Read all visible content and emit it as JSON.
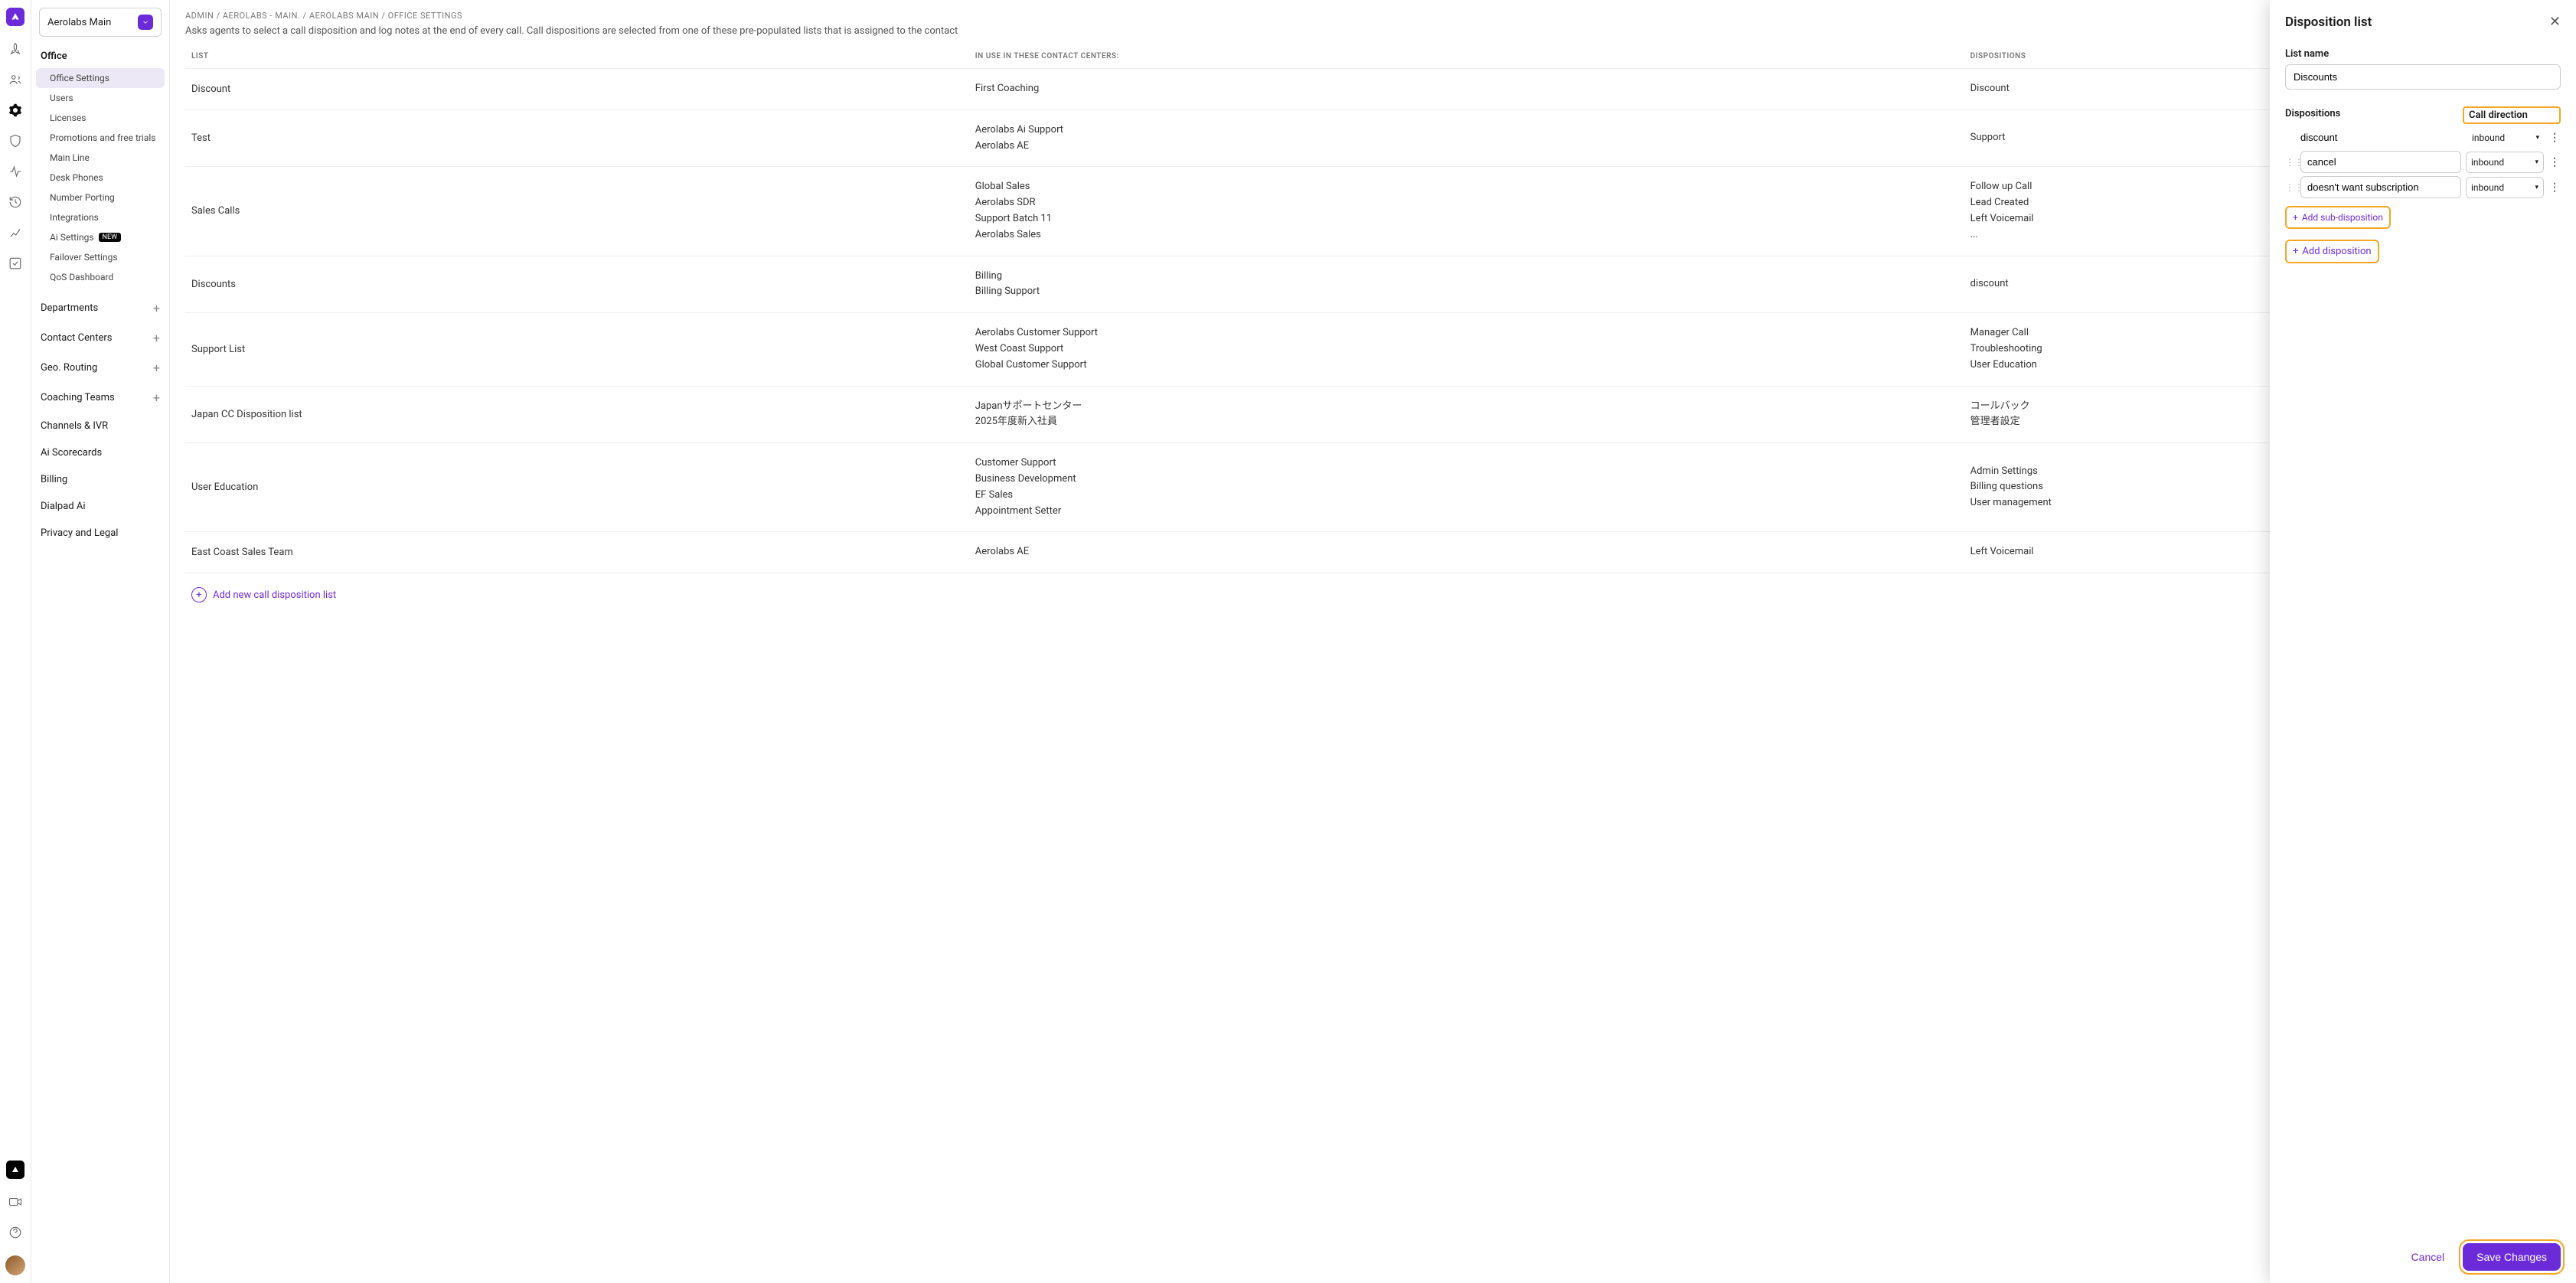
{
  "workspace": "Aerolabs Main",
  "breadcrumb": [
    "ADMIN",
    "AEROLABS - MAIN.",
    "AEROLABS MAIN",
    "OFFICE SETTINGS"
  ],
  "description": "Asks agents to select a call disposition and log notes at the end of every call. Call dispositions are selected from one of these pre-populated lists that is assigned to the contact",
  "sidebar": {
    "sectionOffice": "Office",
    "items": [
      {
        "label": "Office Settings",
        "active": true
      },
      {
        "label": "Users"
      },
      {
        "label": "Licenses"
      },
      {
        "label": "Promotions and free trials"
      },
      {
        "label": "Main Line"
      },
      {
        "label": "Desk Phones"
      },
      {
        "label": "Number Porting"
      },
      {
        "label": "Integrations"
      },
      {
        "label": "Ai Settings",
        "badge": "NEW"
      },
      {
        "label": "Failover Settings"
      },
      {
        "label": "QoS Dashboard"
      }
    ],
    "nav": [
      {
        "label": "Departments",
        "add": true
      },
      {
        "label": "Contact Centers",
        "add": true
      },
      {
        "label": "Geo. Routing",
        "add": true
      },
      {
        "label": "Coaching Teams",
        "add": true
      },
      {
        "label": "Channels & IVR"
      },
      {
        "label": "Ai Scorecards"
      },
      {
        "label": "Billing"
      },
      {
        "label": "Dialpad Ai"
      },
      {
        "label": "Privacy and Legal"
      }
    ]
  },
  "table": {
    "headers": [
      "LIST",
      "IN USE IN THESE CONTACT CENTERS:",
      "DISPOSITIONS"
    ],
    "rows": [
      {
        "list": "Discount",
        "centers": [
          "First Coaching"
        ],
        "disps": [
          "Discount"
        ]
      },
      {
        "list": "Test",
        "centers": [
          "Aerolabs Ai Support",
          "Aerolabs AE"
        ],
        "disps": [
          "Support"
        ]
      },
      {
        "list": "Sales Calls",
        "centers": [
          "Global Sales",
          "Aerolabs SDR",
          "Support Batch 11",
          "Aerolabs Sales"
        ],
        "disps": [
          "Follow up Call",
          "Lead Created",
          "Left Voicemail",
          "..."
        ]
      },
      {
        "list": "Discounts",
        "centers": [
          "Billing",
          "Billing Support"
        ],
        "disps": [
          "discount"
        ]
      },
      {
        "list": "Support List",
        "centers": [
          "Aerolabs Customer Support",
          "West Coast Support",
          "Global Customer Support"
        ],
        "disps": [
          "Manager Call",
          "Troubleshooting",
          "User Education"
        ]
      },
      {
        "list": "Japan CC Disposition list",
        "centers": [
          "Japanサポートセンター",
          "2025年度新入社員"
        ],
        "disps": [
          "コールバック",
          "管理者設定"
        ]
      },
      {
        "list": "User Education",
        "centers": [
          "Customer Support",
          "Business Development",
          "EF Sales",
          "Appointment Setter"
        ],
        "disps": [
          "Admin Settings",
          "Billing questions",
          "User management"
        ]
      },
      {
        "list": "East Coast Sales Team",
        "centers": [
          "Aerolabs AE"
        ],
        "disps": [
          "Left Voicemail"
        ]
      }
    ],
    "addLabel": "Add new call disposition list"
  },
  "panel": {
    "title": "Disposition list",
    "listNameLabel": "List name",
    "listName": "Discounts",
    "dispositionsLabel": "Dispositions",
    "callDirectionLabel": "Call direction",
    "rows": [
      {
        "name": "discount",
        "dir": "inbound",
        "grip": false
      },
      {
        "name": "cancel",
        "dir": "inbound",
        "grip": true
      },
      {
        "name": "doesn't want subscription",
        "dir": "inbound",
        "grip": true
      }
    ],
    "addSub": "Add sub-disposition",
    "addDisp": "Add disposition",
    "cancel": "Cancel",
    "save": "Save Changes"
  }
}
